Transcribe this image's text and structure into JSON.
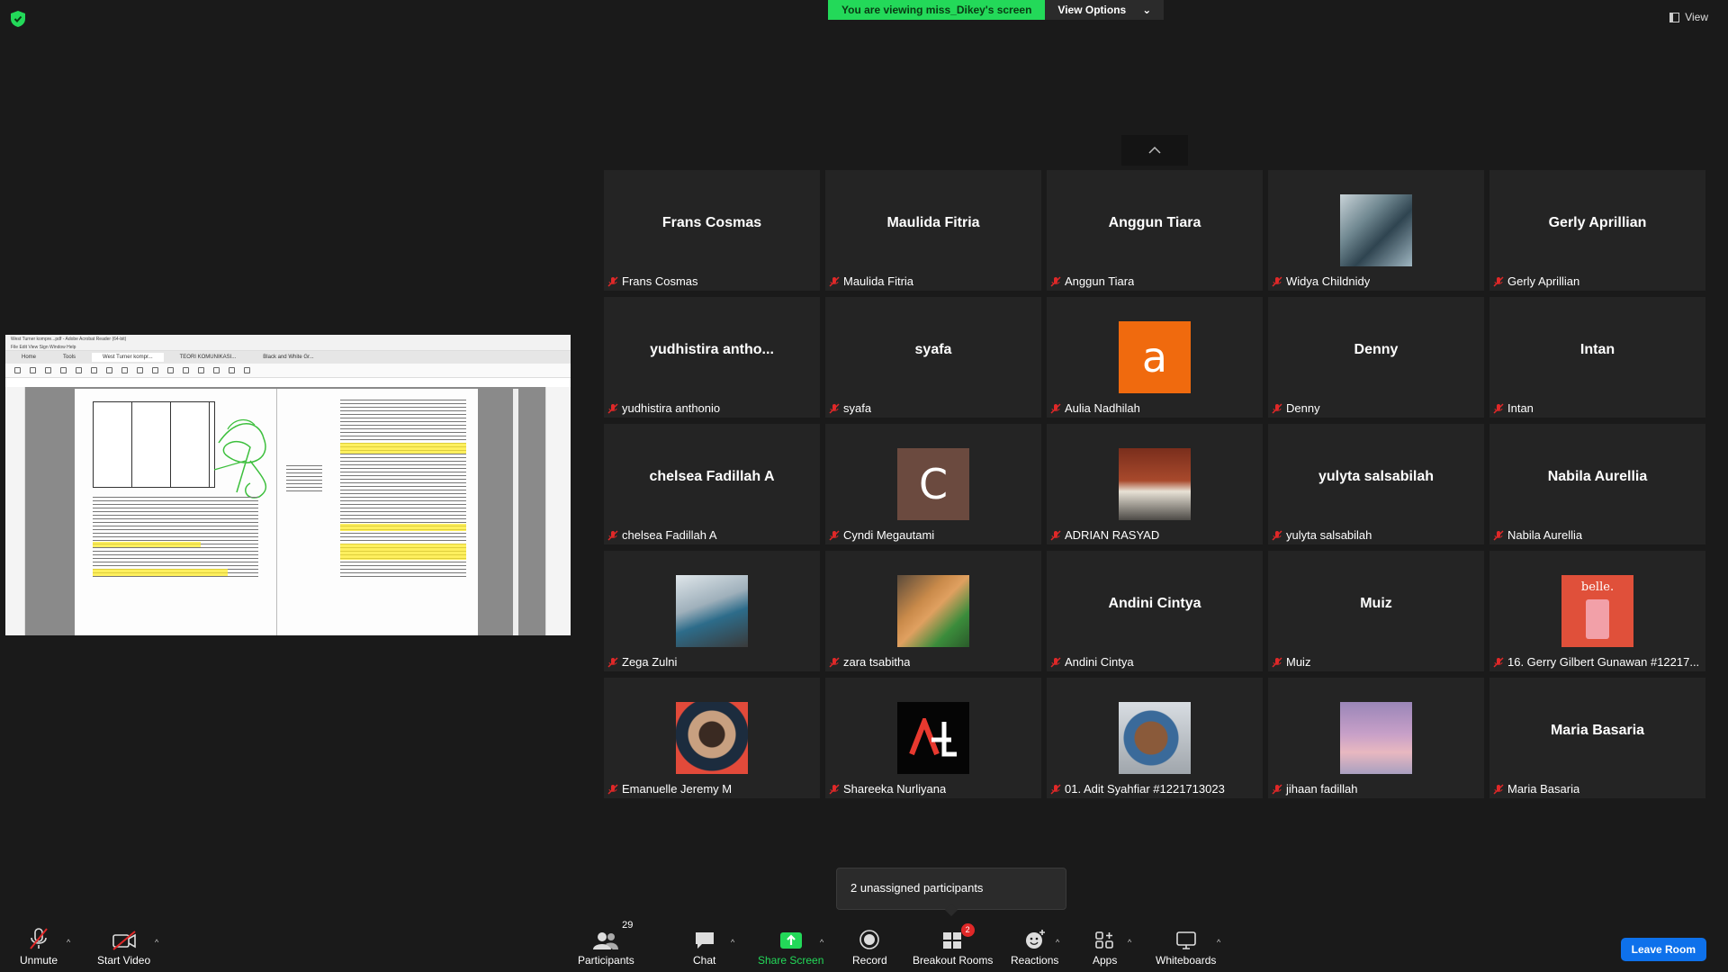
{
  "top": {
    "viewing_text": "You are viewing miss_Dikey's screen",
    "view_options_label": "View Options",
    "view_label": "View"
  },
  "shared_screen": {
    "window_title": "West Turner kompre...pdf - Adobe Acrobat Reader (64-bit)",
    "menu": "File  Edit  View  Sign  Window  Help",
    "tabs": [
      "Home",
      "Tools",
      "West Turner kompr...",
      "TEORI KOMUNIKASI...",
      "Black and White Gr..."
    ]
  },
  "participants": [
    {
      "label": "Frans Cosmas",
      "big": "Frans Cosmas"
    },
    {
      "label": "Maulida Fitria",
      "big": "Maulida Fitria"
    },
    {
      "label": "Anggun Tiara",
      "big": "Anggun Tiara"
    },
    {
      "label": "Widya Childnidy",
      "big": ""
    },
    {
      "label": "Gerly Aprillian",
      "big": "Gerly Aprillian"
    },
    {
      "label": "yudhistira anthonio",
      "big": "yudhistira  antho..."
    },
    {
      "label": "syafa",
      "big": "syafa"
    },
    {
      "label": "Aulia Nadhilah",
      "big": "",
      "letter": "a"
    },
    {
      "label": "Denny",
      "big": "Denny"
    },
    {
      "label": "Intan",
      "big": "Intan"
    },
    {
      "label": "chelsea Fadillah A",
      "big": "chelsea Fadillah A"
    },
    {
      "label": "Cyndi Megautami",
      "big": "",
      "letter": "C"
    },
    {
      "label": "ADRIAN RASYAD",
      "big": ""
    },
    {
      "label": "yulyta salsabilah",
      "big": "yulyta salsabilah"
    },
    {
      "label": "Nabila Aurellia",
      "big": "Nabila Aurellia"
    },
    {
      "label": "Zega Zulni",
      "big": ""
    },
    {
      "label": "zara tsabitha",
      "big": ""
    },
    {
      "label": "Andini Cintya",
      "big": "Andini Cintya"
    },
    {
      "label": "Muiz",
      "big": "Muiz"
    },
    {
      "label": "16. Gerry Gilbert Gunawan #12217...",
      "big": "",
      "avatar_text": "belle."
    },
    {
      "label": "Emanuelle Jeremy M",
      "big": ""
    },
    {
      "label": "Shareeka Nurliyana",
      "big": ""
    },
    {
      "label": "01. Adit Syahfiar #1221713023",
      "big": ""
    },
    {
      "label": "jihaan fadillah",
      "big": ""
    },
    {
      "label": "Maria Basaria",
      "big": "Maria Basaria"
    }
  ],
  "popup": {
    "text": "2 unassigned participants"
  },
  "toolbar": {
    "unmute": "Unmute",
    "start_video": "Start Video",
    "participants": "Participants",
    "participants_count": "29",
    "chat": "Chat",
    "share_screen": "Share Screen",
    "record": "Record",
    "breakout_rooms": "Breakout Rooms",
    "breakout_badge": "2",
    "reactions": "Reactions",
    "apps": "Apps",
    "whiteboards": "Whiteboards",
    "leave_room": "Leave Room"
  },
  "colors": {
    "accent_green": "#23d959",
    "leave_blue": "#0e71eb",
    "muted_red": "#e02828",
    "tile_bg": "#242424",
    "avatar_orange": "#f06a0e",
    "avatar_brown": "#6b4a3f"
  }
}
